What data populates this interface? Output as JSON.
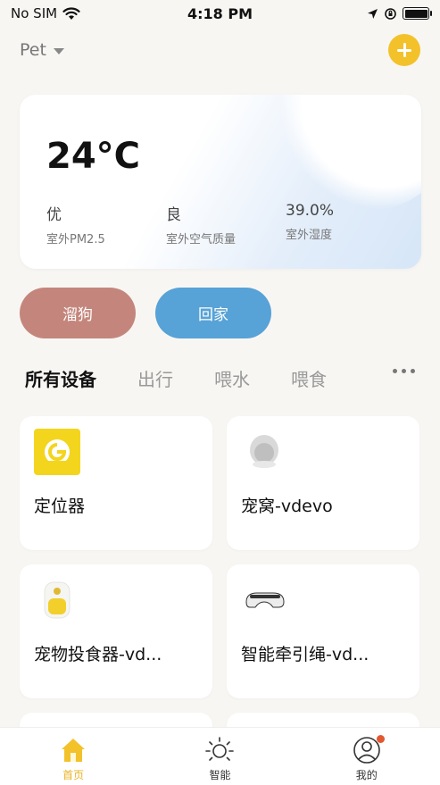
{
  "status_bar": {
    "carrier": "No SIM",
    "time": "4:18 PM"
  },
  "header": {
    "home_name": "Pet"
  },
  "weather": {
    "temperature": "24°C",
    "stats": [
      {
        "value": "优",
        "label": "室外PM2.5"
      },
      {
        "value": "良",
        "label": "室外空气质量"
      },
      {
        "value": "39.0%",
        "label": "室外湿度"
      }
    ]
  },
  "scenes": [
    {
      "label": "溜狗",
      "color": "#c4867c"
    },
    {
      "label": "回家",
      "color": "#57a2d6"
    }
  ],
  "tabs": [
    "所有设备",
    "出行",
    "喂水",
    "喂食"
  ],
  "devices": [
    {
      "name": "定位器",
      "icon": "locator-icon"
    },
    {
      "name": "宠窝-vdevo",
      "icon": "pet-nest-icon"
    },
    {
      "name": "宠物投食器-vd...",
      "icon": "pet-feeder-icon"
    },
    {
      "name": "智能牵引绳-vd...",
      "icon": "smart-leash-icon"
    }
  ],
  "tab_bar": [
    {
      "label": "首页",
      "icon": "home-icon",
      "active": true
    },
    {
      "label": "智能",
      "icon": "sun-icon",
      "active": false
    },
    {
      "label": "我的",
      "icon": "profile-icon",
      "active": false
    }
  ],
  "colors": {
    "accent": "#f3c22a",
    "active_tab": "#e9b324",
    "badge": "#e3582f"
  }
}
